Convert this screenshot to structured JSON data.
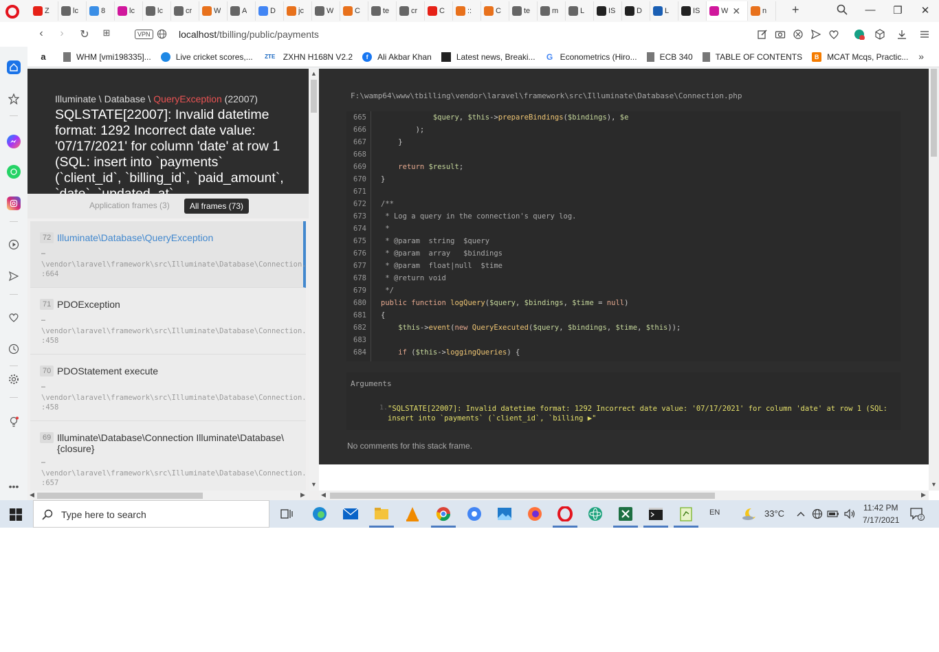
{
  "browser": {
    "tabs": [
      {
        "title": "Z",
        "color": "#e62117",
        "icon": "youtube-icon"
      },
      {
        "title": "lc",
        "color": "#666666",
        "icon": "document-icon"
      },
      {
        "title": "8",
        "color": "#3a8ee6",
        "icon": "t-icon"
      },
      {
        "title": "lc",
        "color": "#d0179c",
        "icon": "m-icon"
      },
      {
        "title": "lc",
        "color": "#666666",
        "icon": "document-icon"
      },
      {
        "title": "cr",
        "color": "#666666",
        "icon": "document-icon"
      },
      {
        "title": "W",
        "color": "#e8711c",
        "icon": "fire-icon"
      },
      {
        "title": "A",
        "color": "#666666",
        "icon": "document-icon"
      },
      {
        "title": "D",
        "color": "#4285f4",
        "icon": "google-icon"
      },
      {
        "title": "jc",
        "color": "#e8711c",
        "icon": "stackoverflow-icon"
      },
      {
        "title": "W",
        "color": "#666666",
        "icon": "document-icon"
      },
      {
        "title": "C",
        "color": "#e8711c",
        "icon": "fire-icon"
      },
      {
        "title": "te",
        "color": "#666666",
        "icon": "document-icon"
      },
      {
        "title": "cr",
        "color": "#666666",
        "icon": "document-icon"
      },
      {
        "title": "C",
        "color": "#e62117",
        "icon": "youtube-icon"
      },
      {
        "title": "::",
        "color": "#e8711c",
        "icon": "fire-icon"
      },
      {
        "title": "C",
        "color": "#e8711c",
        "icon": "fire-icon"
      },
      {
        "title": "te",
        "color": "#666666",
        "icon": "document-icon"
      },
      {
        "title": "m",
        "color": "#666666",
        "icon": "document-icon"
      },
      {
        "title": "L",
        "color": "#666666",
        "icon": "document-icon"
      },
      {
        "title": "IS",
        "color": "#222222",
        "icon": "e-icon"
      },
      {
        "title": "D",
        "color": "#222222",
        "icon": "e-icon"
      },
      {
        "title": "L",
        "color": "#1a5fb4",
        "icon": "l-icon"
      },
      {
        "title": "IS",
        "color": "#222222",
        "icon": "e-icon"
      }
    ],
    "active_tab": {
      "title": "W",
      "color": "#d0179c",
      "icon": "whoops-icon"
    },
    "last_tab": {
      "title": "n",
      "color": "#e8711c",
      "icon": "stackoverflow-icon"
    },
    "vpn_label": "VPN",
    "url_host": "localhost",
    "url_path": "/tbilling/public/payments",
    "bookmarks": [
      {
        "label": "",
        "icon": "amazon-icon",
        "color": "#222222"
      },
      {
        "label": "WHM [vmi198335]...",
        "icon": "document-icon",
        "color": "#555555"
      },
      {
        "label": "Live cricket scores,...",
        "icon": "globe-icon",
        "color": "#1e88e5"
      },
      {
        "label": "ZXHN H168N V2.2",
        "icon": "zte-icon",
        "color": "#1565c0"
      },
      {
        "label": "Ali Akbar Khan",
        "icon": "facebook-icon",
        "color": "#1877f2"
      },
      {
        "label": "Latest news, Breaki...",
        "icon": "news-icon",
        "color": "#222222"
      },
      {
        "label": "Econometrics (Hiro...",
        "icon": "google-icon",
        "color": "#4285f4"
      },
      {
        "label": "ECB 340",
        "icon": "document-icon",
        "color": "#555555"
      },
      {
        "label": "TABLE OF CONTENTS",
        "icon": "document-icon",
        "color": "#555555"
      },
      {
        "label": "MCAT Mcqs, Practic...",
        "icon": "blogger-icon",
        "color": "#f57c00"
      }
    ],
    "bookmarks_more": "»"
  },
  "error_page": {
    "exception_namespace": "Illuminate \\ Database \\ ",
    "exception_name": "QueryException",
    "exception_code": " (22007)",
    "message": "SQLSTATE[22007]: Invalid datetime format: 1292 Incorrect date value: '07/17/2021' for column 'date' at row 1 (SQL: insert into `payments` (`client_id`, `billing_id`, `paid_amount`, `date`, `updated_at`",
    "filters": {
      "application_frames": "Application frames (3)",
      "all_frames": "All frames (73)"
    },
    "frames": [
      {
        "num": "72",
        "class": "Illuminate\\Database\\QueryException",
        "dots": "…",
        "path": "\\vendor\\laravel\\framework\\src\\Illuminate\\Database\\Connection.php",
        "line": ":664"
      },
      {
        "num": "71",
        "class": "PDOException",
        "dots": "…",
        "path": "\\vendor\\laravel\\framework\\src\\Illuminate\\Database\\Connection.php",
        "line": ":458"
      },
      {
        "num": "70",
        "class": "PDOStatement execute",
        "dots": "…",
        "path": "\\vendor\\laravel\\framework\\src\\Illuminate\\Database\\Connection.php",
        "line": ":458"
      },
      {
        "num": "69",
        "class": "Illuminate\\Database\\Connection Illuminate\\Database\\{closure}",
        "dots": "…",
        "path": "\\vendor\\laravel\\framework\\src\\Illuminate\\Database\\Connection.php",
        "line": ":657"
      }
    ],
    "file_path": "F:\\wamp64\\www\\tbilling\\vendor\\laravel\\framework\\src\\Illuminate\\Database\\Connection.php",
    "code_lines": [
      {
        "n": "665",
        "html": "            <span class=\"v\">$query</span>, <span class=\"v\">$this</span>-><span class=\"f\">prepareBindings</span>(<span class=\"v\">$bindings</span>), <span class=\"v\">$e</span>"
      },
      {
        "n": "666",
        "html": "        );"
      },
      {
        "n": "667",
        "html": "    }"
      },
      {
        "n": "668",
        "html": ""
      },
      {
        "n": "669",
        "html": "    <span class=\"k\">return</span> <span class=\"v\">$result</span>;"
      },
      {
        "n": "670",
        "html": "}"
      },
      {
        "n": "671",
        "html": ""
      },
      {
        "n": "672",
        "html": "<span class=\"c\">/**</span>"
      },
      {
        "n": "673",
        "html": "<span class=\"c\"> * Log a query in the connection's query log.</span>"
      },
      {
        "n": "674",
        "html": "<span class=\"c\"> *</span>"
      },
      {
        "n": "675",
        "html": "<span class=\"c\"> * @param  string  $query</span>"
      },
      {
        "n": "676",
        "html": "<span class=\"c\"> * @param  array   $bindings</span>"
      },
      {
        "n": "677",
        "html": "<span class=\"c\"> * @param  float|null  $time</span>"
      },
      {
        "n": "678",
        "html": "<span class=\"c\"> * @return void</span>"
      },
      {
        "n": "679",
        "html": "<span class=\"c\"> */</span>"
      },
      {
        "n": "680",
        "html": "<span class=\"k\">public function</span> <span class=\"f\">logQuery</span>(<span class=\"v\">$query</span>, <span class=\"v\">$bindings</span>, <span class=\"v\">$time</span> = <span class=\"k\">null</span>)"
      },
      {
        "n": "681",
        "html": "{"
      },
      {
        "n": "682",
        "html": "    <span class=\"v\">$this</span>-><span class=\"f\">event</span>(<span class=\"k\">new</span> <span class=\"f\">QueryExecuted</span>(<span class=\"v\">$query</span>, <span class=\"v\">$bindings</span>, <span class=\"v\">$time</span>, <span class=\"v\">$this</span>));"
      },
      {
        "n": "683",
        "html": ""
      },
      {
        "n": "684",
        "html": "    <span class=\"k\">if</span> (<span class=\"v\">$this</span>-><span class=\"f\">loggingQueries</span>) {"
      }
    ],
    "arguments_title": "Arguments",
    "argument_num": "1.",
    "argument_text": "\"SQLSTATE[22007]: Invalid datetime format: 1292 Incorrect date value: '07/17/2021' for column 'date' at row 1 (SQL: insert into `payments` (`client_id`, `billing ▶\"",
    "no_comments": "No comments for this stack frame."
  },
  "taskbar": {
    "search_placeholder": "Type here to search",
    "language": "EN",
    "temperature": "33°C",
    "time": "11:42 PM",
    "date": "7/17/2021",
    "notification_count": "2"
  }
}
